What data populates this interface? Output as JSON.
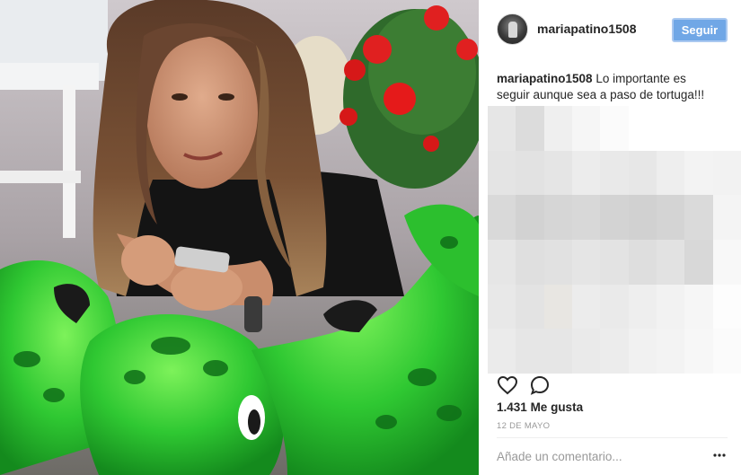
{
  "photo": {
    "description_icon": "photo-woman-on-turtle-float"
  },
  "header": {
    "username": "mariapatino1508",
    "follow_label": "Seguir",
    "avatar_icon": "avatar-icon"
  },
  "caption": {
    "username": "mariapatino1508",
    "text": "Lo importante es seguir aunque sea a paso de tortuga!!!"
  },
  "actions": {
    "like_icon": "heart-icon",
    "comment_icon": "comment-icon"
  },
  "likes": {
    "count": "1.431",
    "label": "Me gusta"
  },
  "date": "12 DE MAYO",
  "comment": {
    "placeholder": "Añade un comentario...",
    "more_icon": "ellipsis-icon"
  },
  "colors": {
    "follow_button": "#70a7e6",
    "text": "#262626",
    "muted": "#999999"
  },
  "pixelation": [
    [
      "#e6e6e6",
      "#dcdcdc",
      "#efefef",
      "#f6f6f6",
      "#fbfbfb",
      "#ffffff",
      "#ffffff",
      "#ffffff",
      "#ffffff"
    ],
    [
      "#e4e4e4",
      "#e2e2e2",
      "#e5e5e5",
      "#ececec",
      "#e9e9e9",
      "#e7e7e7",
      "#eeeeee",
      "#f3f3f3",
      "#f2f2f2"
    ],
    [
      "#d9d9d9",
      "#d2d2d2",
      "#d6d6d6",
      "#d8d8d8",
      "#d3d3d3",
      "#d1d1d1",
      "#d4d4d4",
      "#dadada",
      "#f4f4f4"
    ],
    [
      "#e6e6e6",
      "#dfdfdf",
      "#e1e1e1",
      "#e5e5e5",
      "#e3e3e3",
      "#dedede",
      "#e2e2e2",
      "#d8d8d8",
      "#f8f8f8"
    ],
    [
      "#e8e8e8",
      "#e3e3e3",
      "#e8e6e2",
      "#ececec",
      "#eaeaea",
      "#eeeeee",
      "#f2f2f2",
      "#f6f6f6",
      "#fdfdfd"
    ],
    [
      "#ebebeb",
      "#e6e6e6",
      "#e6e6e6",
      "#eaeaea",
      "#ececec",
      "#f1f1f1",
      "#f3f3f3",
      "#f7f7f7",
      "#fbfbfb"
    ]
  ]
}
